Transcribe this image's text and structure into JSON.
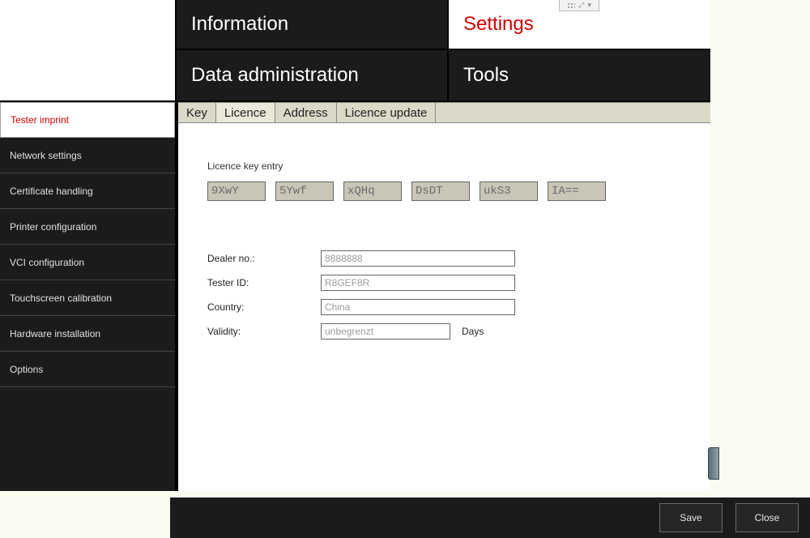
{
  "main_tabs": {
    "information": "Information",
    "settings": "Settings",
    "data_admin": "Data administration",
    "tools": "Tools"
  },
  "sidebar": {
    "items": [
      "Tester imprint",
      "Network settings",
      "Certificate handling",
      "Printer configuration",
      "VCI configuration",
      "Touchscreen calibration",
      "Hardware installation",
      "Options"
    ]
  },
  "subtabs": {
    "key": "Key",
    "licence": "Licence",
    "address": "Address",
    "licence_update": "Licence update"
  },
  "licence": {
    "section_label": "Licence key entry",
    "keys": [
      "9XwY",
      "5Ywf",
      "xQHq",
      "DsDT",
      "ukS3",
      "IA=="
    ],
    "dealer_label": "Dealer no.:",
    "dealer_value": "8888888",
    "tester_label": "Tester ID:",
    "tester_value": "R8GEF8R",
    "country_label": "Country:",
    "country_value": "China",
    "validity_label": "Validity:",
    "validity_value": "unbegrenzt",
    "validity_suffix": "Days"
  },
  "footer": {
    "save": "Save",
    "close": "Close"
  }
}
